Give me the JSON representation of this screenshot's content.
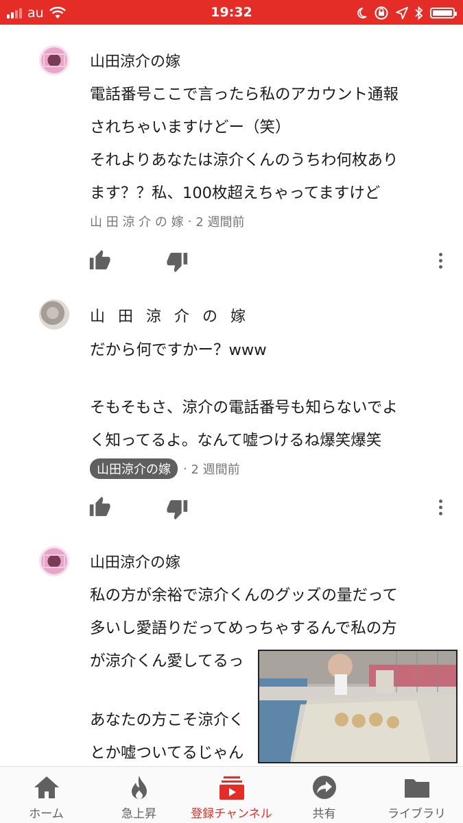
{
  "status_bar": {
    "carrier": "au",
    "time": "19:32",
    "signal_bars_filled": 2,
    "battery_level": 1.0,
    "icons": [
      "wifi-icon",
      "moon-icon",
      "rotation-lock-icon",
      "location-icon",
      "bluetooth-icon",
      "battery-icon"
    ]
  },
  "comments": [
    {
      "author": "山田涼介の嫁",
      "lines": [
        "電話番号ここで言ったら私のアカウント通報",
        "されちゃいますけどー（笑）",
        "それよりあなたは涼介くんのうちわ何枚あり",
        "ます？？私、100枚超えちゃってますけど"
      ],
      "meta_author": "山 田 涼 介 の 嫁",
      "time": "2 週間前"
    },
    {
      "author": "山 田 涼 介 の 嫁",
      "lines": [
        "だから何ですかー？www",
        "",
        "そもそもさ、涼介の電話番号も知らないでよ",
        "く知ってるよ。なんて嘘つけるね爆笑爆笑"
      ],
      "meta_author": "山田涼介の嫁",
      "time": "2 週間前"
    },
    {
      "author": "山田涼介の嫁",
      "lines": [
        "私の方が余裕で涼介くんのグッズの量だって",
        "多いし愛語りだってめっちゃするんで私の方",
        "が涼介くん愛してるっ",
        "",
        "あなたの方こそ涼介く",
        "とか嘘ついてるじゃん"
      ]
    }
  ],
  "nav": [
    {
      "label": "ホーム",
      "icon": "home-icon"
    },
    {
      "label": "急上昇",
      "icon": "flame-icon"
    },
    {
      "label": "登録チャンネル",
      "icon": "subscriptions-icon",
      "active": true
    },
    {
      "label": "共有",
      "icon": "share-icon"
    },
    {
      "label": "ライブラリ",
      "icon": "folder-icon"
    }
  ],
  "colors": {
    "brand_red": "#e52d27",
    "meta_gray": "#757575",
    "chip_gray": "#5f5f5f"
  }
}
